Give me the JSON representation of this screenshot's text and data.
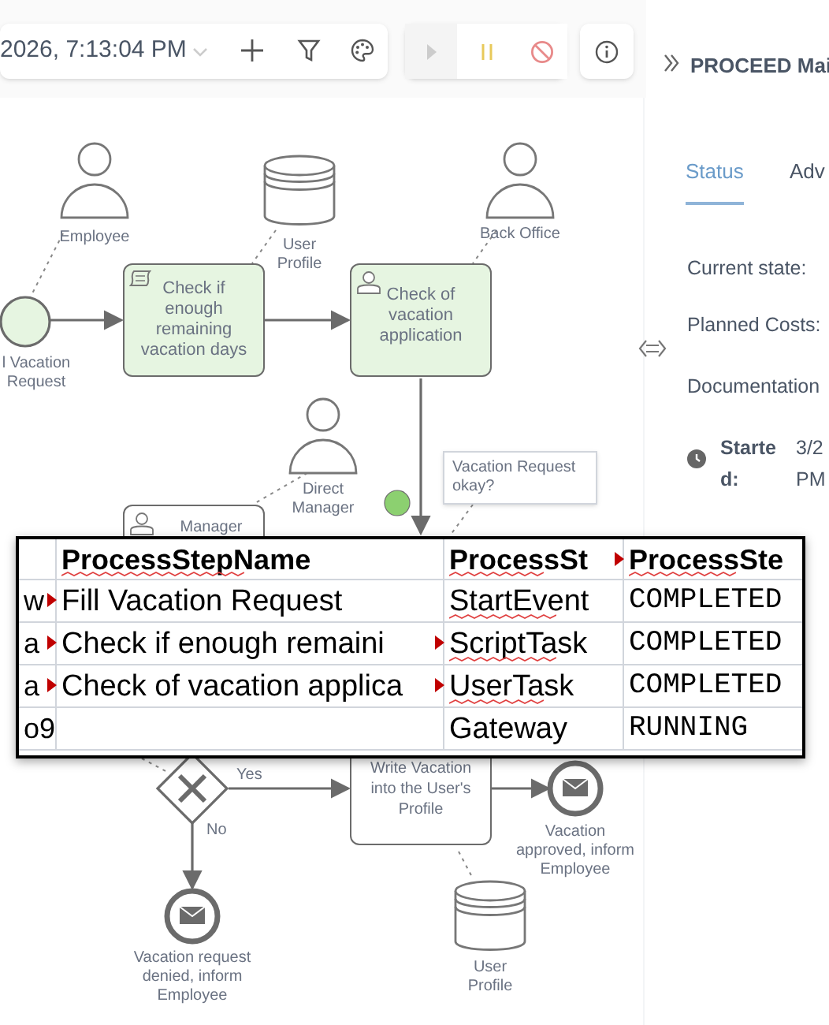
{
  "toolbar": {
    "date_text": "2026, 7:13:04 PM",
    "playback": [
      {
        "kind": "play",
        "disabled": true
      },
      {
        "kind": "pause",
        "disabled": false
      },
      {
        "kind": "stop",
        "disabled": false
      }
    ]
  },
  "panel": {
    "breadcrumb": "PROCEED Mai",
    "tabs": [
      {
        "label": "Status",
        "selected": true
      },
      {
        "label": "Adv",
        "selected": false
      }
    ],
    "fields": [
      "Current state:",
      "Planned Costs:",
      "Documentation"
    ],
    "started": {
      "label": "Started:",
      "value": "3/2 PM"
    }
  },
  "diagram": [
    {
      "kind": "person",
      "label": "Employee"
    },
    {
      "kind": "start",
      "label": "l Vacation Request",
      "completed": true
    },
    {
      "kind": "script_task",
      "label": "Check if enough remaining vacation days",
      "completed": true
    },
    {
      "kind": "store",
      "label": "User Profile"
    },
    {
      "kind": "user_task",
      "label": "Check of vacation application",
      "completed": true
    },
    {
      "kind": "person",
      "label": "Back Office"
    },
    {
      "kind": "person",
      "label": "Direct Manager"
    },
    {
      "kind": "annotation",
      "label": "Vacation Request okay?"
    },
    {
      "kind": "user_task",
      "label": "Manager",
      "completed": false
    },
    {
      "kind": "task",
      "label": "Write Vacation into the User's Profile",
      "completed": false
    },
    {
      "kind": "end",
      "label": "Vacation approved, inform Employee"
    },
    {
      "kind": "end",
      "label": "Vacation request denied, inform Employee"
    },
    {
      "kind": "store",
      "label": "User Profile"
    },
    {
      "kind": "flow_label",
      "label": "Yes"
    },
    {
      "kind": "flow_label",
      "label": "No"
    }
  ],
  "spreadsheet": {
    "columns": [
      {
        "text": "ProcessStepName",
        "overflow": false,
        "misspelled": true
      },
      {
        "text": "ProcessSt",
        "overflow": true,
        "misspelled": true
      },
      {
        "text": "ProcessSte",
        "overflow": false,
        "misspelled": true
      }
    ],
    "rows": [
      {
        "lead": {
          "text": "w",
          "overflow": true
        },
        "cells": [
          {
            "text": "Fill Vacation Request",
            "overflow": false,
            "misspelled": false
          },
          {
            "text": "StartEvent",
            "overflow": false,
            "misspelled": true
          },
          {
            "text": "COMPLETED",
            "overflow": false,
            "misspelled": false
          }
        ]
      },
      {
        "lead": {
          "text": "a",
          "overflow": true
        },
        "cells": [
          {
            "text": "Check if enough remaini",
            "overflow": true,
            "misspelled": false
          },
          {
            "text": "ScriptTask",
            "overflow": false,
            "misspelled": true
          },
          {
            "text": "COMPLETED",
            "overflow": false,
            "misspelled": false
          }
        ]
      },
      {
        "lead": {
          "text": "a",
          "overflow": true
        },
        "cells": [
          {
            "text": "Check of vacation applica",
            "overflow": true,
            "misspelled": false
          },
          {
            "text": "UserTask",
            "overflow": false,
            "misspelled": true
          },
          {
            "text": "COMPLETED",
            "overflow": false,
            "misspelled": false
          }
        ]
      },
      {
        "lead": {
          "text": "o9",
          "overflow": false
        },
        "cells": [
          {
            "overflow": false,
            "misspelled": false
          },
          {
            "text": "Gateway",
            "overflow": false,
            "misspelled": false
          },
          {
            "text": "RUNNING",
            "overflow": false,
            "misspelled": false
          }
        ]
      }
    ]
  }
}
